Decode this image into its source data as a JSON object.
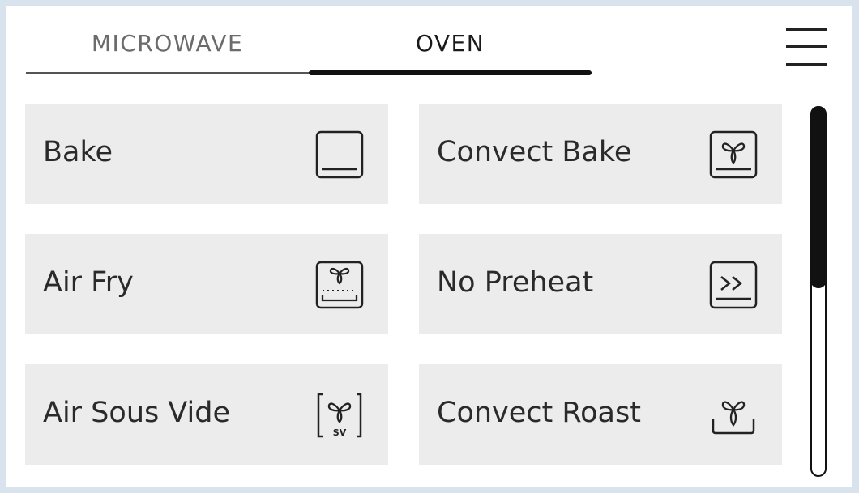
{
  "tabs": [
    {
      "label": "MICROWAVE",
      "active": false
    },
    {
      "label": "OVEN",
      "active": true
    }
  ],
  "menu": {
    "icon": "hamburger-menu-icon"
  },
  "modes": [
    {
      "label": "Bake",
      "icon": "bake-icon"
    },
    {
      "label": "Convect Bake",
      "icon": "convect-bake-icon"
    },
    {
      "label": "Air Fry",
      "icon": "air-fry-icon"
    },
    {
      "label": "No Preheat",
      "icon": "no-preheat-icon"
    },
    {
      "label": "Air Sous Vide",
      "icon": "air-sous-vide-icon",
      "icon_text": "SV"
    },
    {
      "label": "Convect Roast",
      "icon": "convect-roast-icon"
    }
  ],
  "scrollbar": {
    "position": 0.0,
    "visible_fraction": 0.49
  },
  "colors": {
    "background": "#d8e3ee",
    "card": "#ececec",
    "text": "#2a2a2a",
    "active_tab": "#1a1a1a",
    "inactive_tab": "#6b6b6b"
  }
}
